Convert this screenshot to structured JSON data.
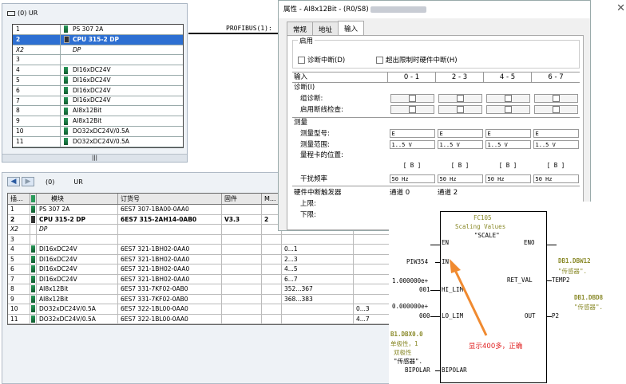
{
  "rack": {
    "title": "(0) UR",
    "rows": [
      {
        "slot": "1",
        "module": "PS 307 2A",
        "icon": "module-icon"
      },
      {
        "slot": "2",
        "module": "CPU 315-2 DP",
        "icon": "cpu-icon",
        "selected": true
      },
      {
        "slot": "X2",
        "module": "DP",
        "icon": "none"
      },
      {
        "slot": "3",
        "module": "",
        "icon": "none"
      },
      {
        "slot": "4",
        "module": "DI16xDC24V",
        "icon": "module-icon"
      },
      {
        "slot": "5",
        "module": "DI16xDC24V",
        "icon": "module-icon"
      },
      {
        "slot": "6",
        "module": "DI16xDC24V",
        "icon": "module-icon"
      },
      {
        "slot": "7",
        "module": "DI16xDC24V",
        "icon": "module-icon"
      },
      {
        "slot": "8",
        "module": "AI8x12Bit",
        "icon": "module-icon"
      },
      {
        "slot": "9",
        "module": "AI8x12Bit",
        "icon": "module-icon"
      },
      {
        "slot": "10",
        "module": "DO32xDC24V/0.5A",
        "icon": "module-icon"
      },
      {
        "slot": "11",
        "module": "DO32xDC24V/0.5A",
        "icon": "module-icon"
      }
    ],
    "scroll_label": "|||"
  },
  "profibus_label": "PROFIBUS(1):",
  "detail": {
    "station": "(0)",
    "rack": "UR",
    "headers": [
      "插...",
      "",
      "模块",
      "订货号",
      "固件",
      "M...",
      "",
      ""
    ],
    "rows": [
      {
        "slot": "1",
        "module": "PS 307 2A",
        "order": "6ES7 307-1BA00-0AA0",
        "fw": "",
        "m": "",
        "i": "",
        "q": ""
      },
      {
        "slot": "2",
        "module": "CPU 315-2 DP",
        "order": "6ES7 315-2AH14-0AB0",
        "fw": "V3.3",
        "m": "2",
        "i": "",
        "q": "",
        "bold": true
      },
      {
        "slot": "X2",
        "module": "DP",
        "order": "",
        "fw": "",
        "m": "",
        "i": "",
        "q": ""
      },
      {
        "slot": "3",
        "module": "",
        "order": "",
        "fw": "",
        "m": "",
        "i": "",
        "q": ""
      },
      {
        "slot": "4",
        "module": "DI16xDC24V",
        "order": "6ES7 321-1BH02-0AA0",
        "fw": "",
        "m": "",
        "i": "0...1",
        "q": ""
      },
      {
        "slot": "5",
        "module": "DI16xDC24V",
        "order": "6ES7 321-1BH02-0AA0",
        "fw": "",
        "m": "",
        "i": "2...3",
        "q": ""
      },
      {
        "slot": "6",
        "module": "DI16xDC24V",
        "order": "6ES7 321-1BH02-0AA0",
        "fw": "",
        "m": "",
        "i": "4...5",
        "q": ""
      },
      {
        "slot": "7",
        "module": "DI16xDC24V",
        "order": "6ES7 321-1BH02-0AA0",
        "fw": "",
        "m": "",
        "i": "6...7",
        "q": ""
      },
      {
        "slot": "8",
        "module": "AI8x12Bit",
        "order": "6ES7 331-7KF02-0AB0",
        "fw": "",
        "m": "",
        "i": "352...367",
        "q": ""
      },
      {
        "slot": "9",
        "module": "AI8x12Bit",
        "order": "6ES7 331-7KF02-0AB0",
        "fw": "",
        "m": "",
        "i": "368...383",
        "q": ""
      },
      {
        "slot": "10",
        "module": "DO32xDC24V/0.5A",
        "order": "6ES7 322-1BL00-0AA0",
        "fw": "",
        "m": "",
        "i": "",
        "q": "0...3"
      },
      {
        "slot": "11",
        "module": "DO32xDC24V/0.5A",
        "order": "6ES7 322-1BL00-0AA0",
        "fw": "",
        "m": "",
        "i": "",
        "q": "4...7"
      }
    ]
  },
  "props": {
    "title": "属性 - AI8x12Bit - (R0/S8)",
    "tabs": [
      "常规",
      "地址",
      "输入"
    ],
    "enable_group": "启用",
    "diag_interrupt": "诊断中断(D)",
    "limit_interrupt": "超出限制时硬件中断(H)",
    "input_header": "输入",
    "channel_headers": [
      "0 - 1",
      "2 - 3",
      "4 - 5",
      "6 - 7"
    ],
    "diag_section": "诊断(I)",
    "group_diag": "组诊断:",
    "wire_break": "启用断线检查:",
    "measure_section": "测量",
    "meas_type": "测量型号:",
    "meas_type_values": [
      "E",
      "E",
      "E",
      "E"
    ],
    "meas_range": "测量范围:",
    "meas_range_values": [
      "1..5 V",
      "1..5 V",
      "1..5 V",
      "1..5 V"
    ],
    "module_pos": "量程卡的位置:",
    "module_pos_values": [
      "[ B ]",
      "[ B ]",
      "[ B ]",
      "[ B ]"
    ],
    "noise_freq": "干扰频率",
    "noise_values": [
      "50 Hz",
      "50 Hz",
      "50 Hz",
      "50 Hz"
    ],
    "hw_trigger": "硬件中断触发器",
    "upper": "上限:",
    "lower": "下限:",
    "channel0": "通道 0",
    "channel2": "通道 2"
  },
  "fc": {
    "name": "FC105",
    "subtitle": "Scaling Values",
    "symbol": "\"SCALE\"",
    "en": "EN",
    "eno": "ENO",
    "in_label": "IN",
    "in_value": "PIW354",
    "hi_lim": "HI_LIM",
    "hi_value_1": "1.000000e+",
    "hi_value_2": "001",
    "lo_lim": "LO_LIM",
    "lo_value_1": "0.000000e+",
    "lo_value_2": "000",
    "ret_val": "RET_VAL",
    "ret_target_1": "DB1.DBW12",
    "ret_target_2": "\"传感器\".",
    "ret_target_3": "TEMP2",
    "out": "OUT",
    "out_target_1": "DB1.DBD8",
    "out_target_2": "\"传感器\".",
    "out_target_3": "P2",
    "bipolar_1": "B1.DBX0.0",
    "bipolar_2": "单极性，1",
    "bipolar_3": "双极性",
    "bipolar_4": "\"传感器\".",
    "bipolar_5": "BIPOLAR",
    "bipolar_pin": "BIPOLAR",
    "annotation": "显示400多，正确"
  },
  "colors": {
    "selection": "#2d6fd2",
    "annotation": "#e02020",
    "comment": "#8a8a2a",
    "arrow": "#f08a30"
  }
}
